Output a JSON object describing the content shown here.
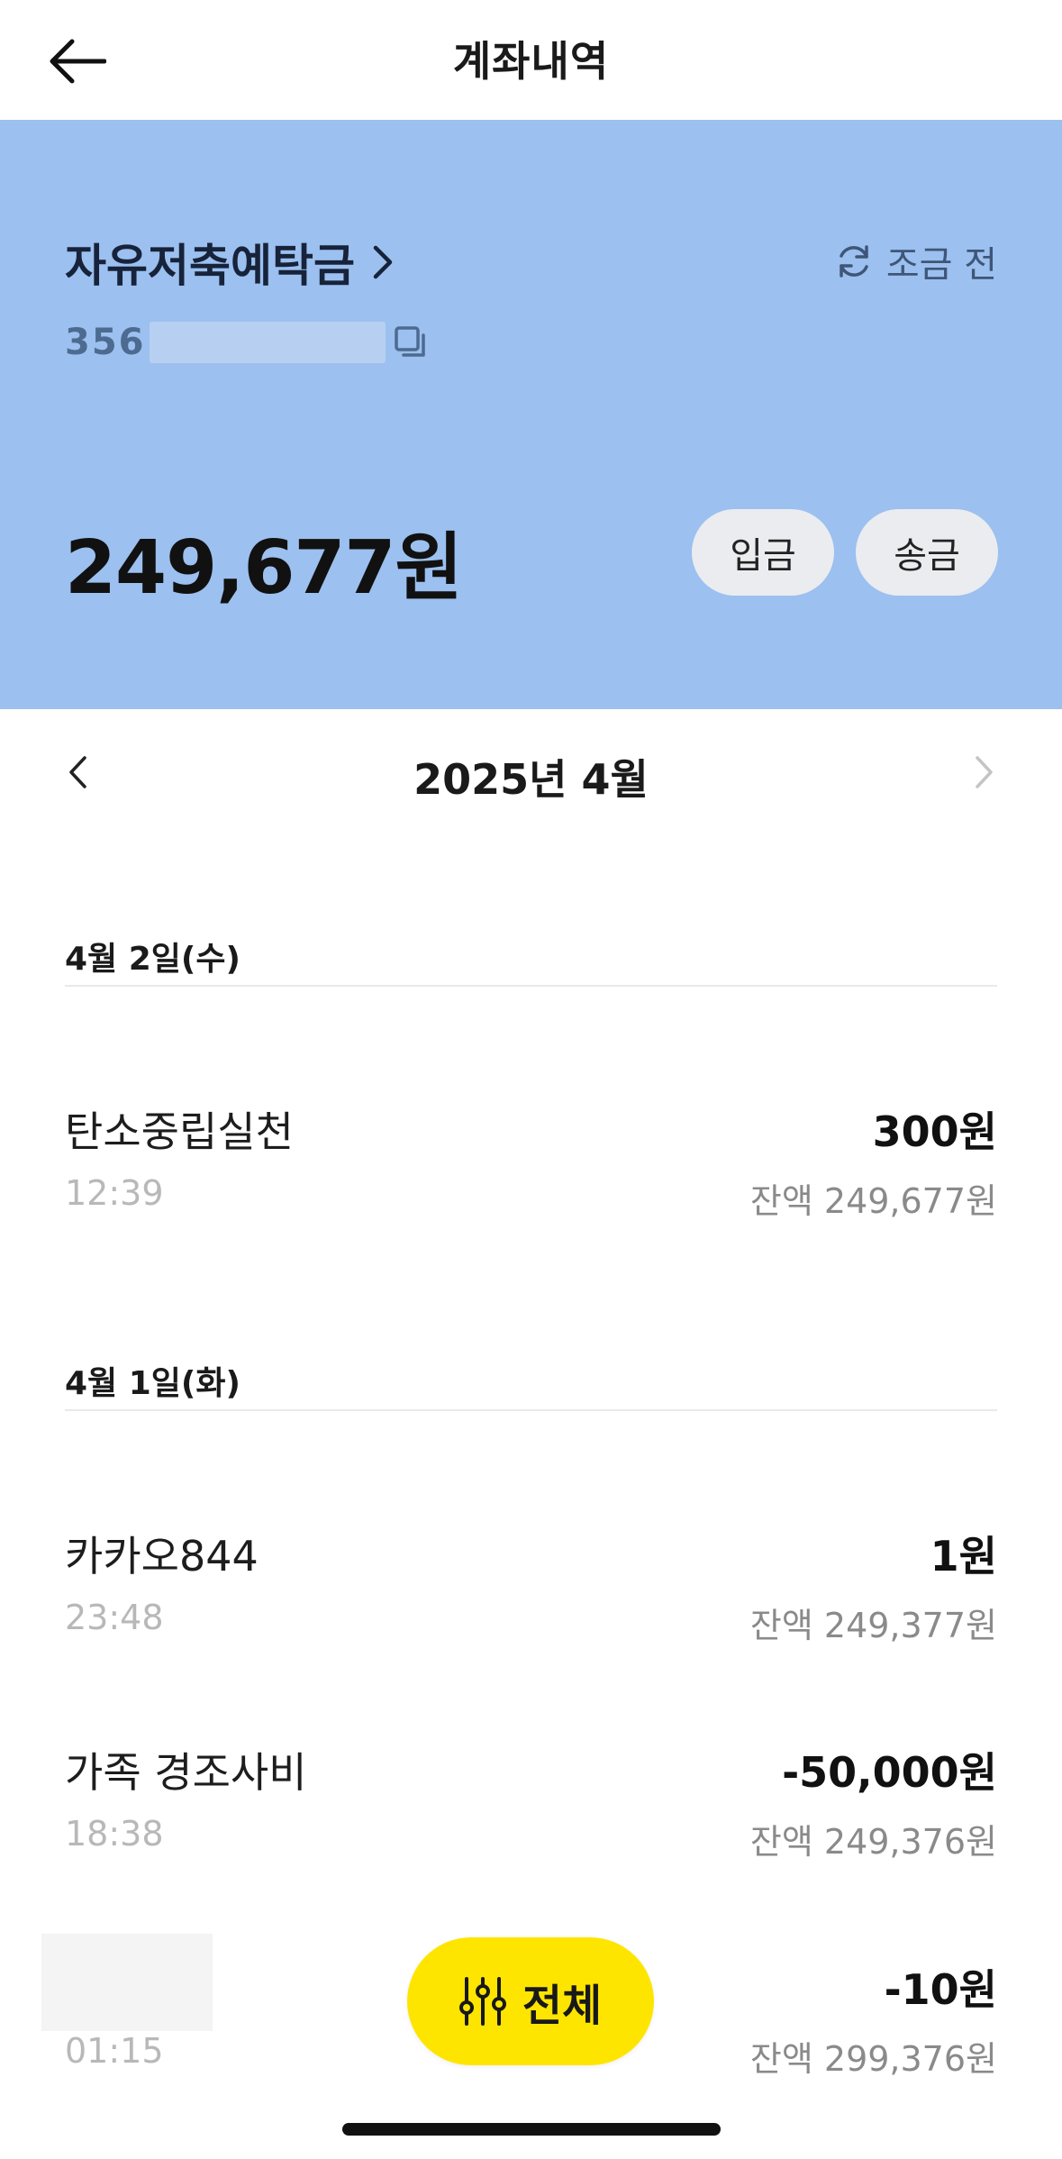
{
  "header": {
    "title": "계좌내역"
  },
  "account": {
    "name": "자유저축예탁금",
    "number_prefix": "356",
    "refresh_label": "조금 전",
    "balance": "249,677원",
    "deposit_label": "입금",
    "transfer_label": "송금",
    "card_color": "#9cc0ef"
  },
  "month_nav": {
    "label": "2025년 4월"
  },
  "days": [
    {
      "date": "4월 2일(수)",
      "transactions": [
        {
          "name": "탄소중립실천",
          "time": "12:39",
          "amount": "300원",
          "balance": "잔액 249,677원"
        }
      ]
    },
    {
      "date": "4월 1일(화)",
      "transactions": [
        {
          "name": "카카오844",
          "time": "23:48",
          "amount": "1원",
          "balance": "잔액 249,377원"
        },
        {
          "name": "가족 경조사비",
          "time": "18:38",
          "amount": "-50,000원",
          "balance": "잔액 249,376원"
        },
        {
          "name": "",
          "time": "01:15",
          "amount": "-10원",
          "balance": "잔액 299,376원"
        }
      ]
    }
  ],
  "filter": {
    "label": "전체",
    "color": "#fee500"
  },
  "icons": {
    "back": "arrow-left-icon",
    "account_chevron": "chevron-right-icon",
    "refresh": "refresh-icon",
    "copy": "copy-icon",
    "prev_month": "chevron-left-icon",
    "next_month": "chevron-right-icon",
    "filter": "sliders-icon"
  }
}
